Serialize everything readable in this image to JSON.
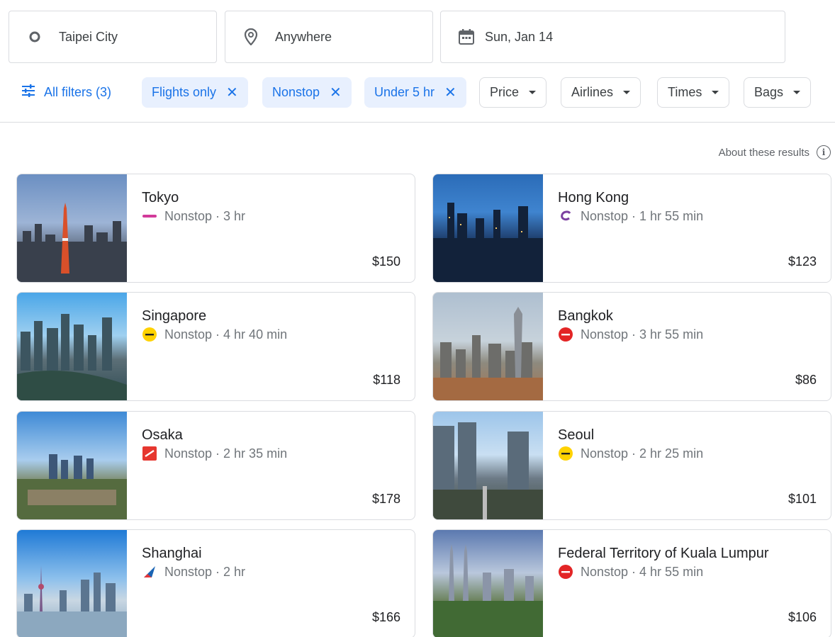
{
  "search": {
    "origin": "Taipei City",
    "destination": "Anywhere",
    "date": "Sun, Jan 14"
  },
  "filters": {
    "all_filters_label": "All filters (3)",
    "active_chips": [
      "Flights only",
      "Nonstop",
      "Under 5 hr"
    ],
    "dropdowns": [
      "Price",
      "Airlines",
      "Times",
      "Bags"
    ]
  },
  "about_label": "About these results",
  "results": [
    {
      "city": "Tokyo",
      "details": "Nonstop · 3 hr",
      "price": "$150",
      "airline_icon": "peach-logo"
    },
    {
      "city": "Hong Kong",
      "details": "Nonstop · 1 hr 55 min",
      "price": "$123",
      "airline_icon": "hk-express-logo"
    },
    {
      "city": "Singapore",
      "details": "Nonstop · 4 hr 40 min",
      "price": "$118",
      "airline_icon": "scoot-logo"
    },
    {
      "city": "Bangkok",
      "details": "Nonstop · 3 hr 55 min",
      "price": "$86",
      "airline_icon": "airasia-logo"
    },
    {
      "city": "Osaka",
      "details": "Nonstop · 2 hr 35 min",
      "price": "$178",
      "airline_icon": "tigerair-logo"
    },
    {
      "city": "Seoul",
      "details": "Nonstop · 2 hr 25 min",
      "price": "$101",
      "airline_icon": "scoot-logo"
    },
    {
      "city": "Shanghai",
      "details": "Nonstop · 2 hr",
      "price": "$166",
      "airline_icon": "china-southern-logo"
    },
    {
      "city": "Federal Territory of Kuala Lumpur",
      "details": "Nonstop · 4 hr 55 min",
      "price": "$106",
      "airline_icon": "airasia-logo"
    }
  ],
  "colors": {
    "accent": "#1a73e8",
    "chip_active_bg": "#e8f0fe",
    "border": "#dadce0"
  }
}
